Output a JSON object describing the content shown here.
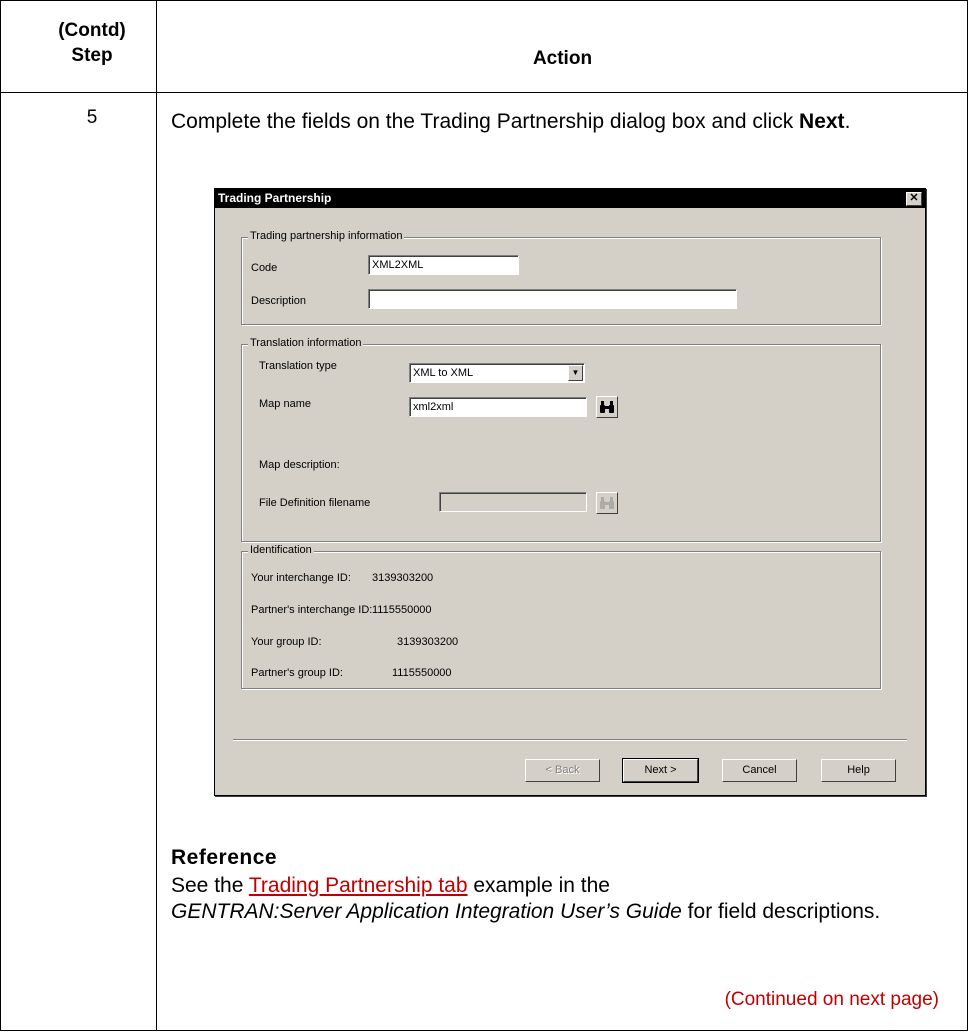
{
  "table": {
    "header_step_line1": "(Contd)",
    "header_step_line2": "Step",
    "header_action": "Action",
    "step_number": "5",
    "instruction_before": "Complete the fields on the Trading Partnership dialog box and click ",
    "instruction_bold": "Next",
    "instruction_after": "."
  },
  "dialog": {
    "title": "Trading Partnership",
    "close_glyph": "✕",
    "group_tp": {
      "label": "Trading partnership information",
      "code_label": "Code",
      "code_value": "XML2XML",
      "description_label": "Description",
      "description_value": ""
    },
    "group_translation": {
      "label": "Translation information",
      "type_label": "Translation type",
      "type_value": "XML to XML",
      "map_name_label": "Map name",
      "map_name_value": "xml2xml",
      "map_description_label": "Map description:",
      "file_def_label": "File Definition filename",
      "file_def_value": ""
    },
    "group_identification": {
      "label": "Identification",
      "your_interchange_label": "Your interchange ID:",
      "your_interchange_value": "3139303200",
      "partner_interchange_label": "Partner's interchange ID:",
      "partner_interchange_value": "1115550000",
      "your_group_label": "Your group ID:",
      "your_group_value": "3139303200",
      "partner_group_label": "Partner's group ID:",
      "partner_group_value": "1115550000"
    },
    "buttons": {
      "back": "< Back",
      "next": "Next >",
      "cancel": "Cancel",
      "help": "Help"
    }
  },
  "reference": {
    "title": "Reference",
    "text_before": "See the ",
    "link": "Trading Partnership tab",
    "text_after_link": " example in the",
    "italic": "GENTRAN:Server Application Integration User’s Guide",
    "text_after_italic": " for field descriptions.",
    "continued": "(Continued on next page)"
  },
  "colors": {
    "link": "#c00000",
    "dialog_bg": "#d4d0c8",
    "title_bar": "#000000"
  },
  "icons": [
    "binoculars-icon",
    "close-icon",
    "dropdown-arrow-icon"
  ]
}
